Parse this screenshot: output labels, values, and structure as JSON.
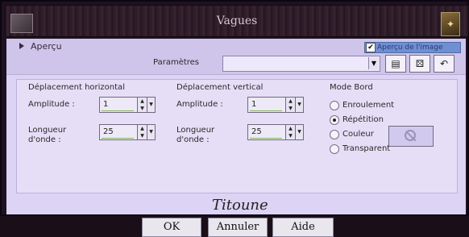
{
  "window": {
    "title": "Vagues"
  },
  "preview": {
    "toggle_label": "Aperçu",
    "show_image_label": "Aperçu de l'image",
    "show_image_checked": true
  },
  "params": {
    "label": "Paramètres"
  },
  "horizontal": {
    "heading": "Déplacement horizontal",
    "amplitude_label": "Amplitude :",
    "amplitude_value": "1",
    "wavelength_label_1": "Longueur",
    "wavelength_label_2": "d'onde :",
    "wavelength_value": "25"
  },
  "vertical": {
    "heading": "Déplacement vertical",
    "amplitude_label": "Amplitude :",
    "amplitude_value": "1",
    "wavelength_label_1": "Longueur",
    "wavelength_label_2": "d'onde :",
    "wavelength_value": "25"
  },
  "mode": {
    "heading": "Mode Bord",
    "options": [
      "Enroulement",
      "Répétition",
      "Couleur",
      "Transparent"
    ],
    "selected": "Répétition"
  },
  "signature": "Titoune",
  "buttons": {
    "ok": "OK",
    "cancel": "Annuler",
    "help": "Aide"
  },
  "icons": {
    "save": "save-icon",
    "random": "dice-icon",
    "reset": "reset-icon",
    "no_color": "no-color-icon"
  }
}
